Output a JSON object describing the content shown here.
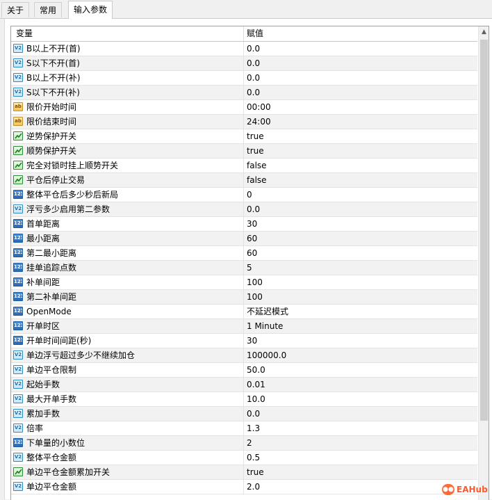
{
  "tabs": [
    {
      "label": "关于",
      "active": false
    },
    {
      "label": "常用",
      "active": false
    },
    {
      "label": "输入参数",
      "active": true
    }
  ],
  "columns": {
    "variable": "变量",
    "value": "赋值"
  },
  "icon_legend": {
    "V2": "double-value-icon",
    "123": "integer-value-icon",
    "ab": "string-value-icon",
    "bool": "boolean-value-icon"
  },
  "rows": [
    {
      "type": "V2",
      "name": "B以上不开(首)",
      "value": "0.0"
    },
    {
      "type": "V2",
      "name": "S以下不开(首)",
      "value": "0.0"
    },
    {
      "type": "V2",
      "name": "B以上不开(补)",
      "value": "0.0"
    },
    {
      "type": "V2",
      "name": "S以下不开(补)",
      "value": "0.0"
    },
    {
      "type": "ab",
      "name": "限价开始时间",
      "value": "00:00"
    },
    {
      "type": "ab",
      "name": "限价结束时间",
      "value": "24:00"
    },
    {
      "type": "bool",
      "name": "逆势保护开关",
      "value": "true"
    },
    {
      "type": "bool",
      "name": "顺势保护开关",
      "value": "true"
    },
    {
      "type": "bool",
      "name": "完全对锁时挂上顺势开关",
      "value": "false"
    },
    {
      "type": "bool",
      "name": "平仓后停止交易",
      "value": "false"
    },
    {
      "type": "123",
      "name": "整体平仓后多少秒后新局",
      "value": "0"
    },
    {
      "type": "V2",
      "name": "浮亏多少启用第二参数",
      "value": "0.0"
    },
    {
      "type": "123",
      "name": "首单距离",
      "value": "30"
    },
    {
      "type": "123",
      "name": "最小距离",
      "value": "60"
    },
    {
      "type": "123",
      "name": "第二最小距离",
      "value": "60"
    },
    {
      "type": "123",
      "name": "挂单追踪点数",
      "value": "5"
    },
    {
      "type": "123",
      "name": "补单间距",
      "value": "100"
    },
    {
      "type": "123",
      "name": "第二补单间距",
      "value": "100"
    },
    {
      "type": "123",
      "name": "OpenMode",
      "value": "不延迟模式"
    },
    {
      "type": "123",
      "name": "开单时区",
      "value": "1 Minute"
    },
    {
      "type": "123",
      "name": "开单时间间距(秒)",
      "value": "30"
    },
    {
      "type": "V2",
      "name": "单边浮亏超过多少不继续加仓",
      "value": "100000.0"
    },
    {
      "type": "V2",
      "name": "单边平仓限制",
      "value": "50.0"
    },
    {
      "type": "V2",
      "name": "起始手数",
      "value": "0.01"
    },
    {
      "type": "V2",
      "name": "最大开单手数",
      "value": "10.0"
    },
    {
      "type": "V2",
      "name": "累加手数",
      "value": "0.0"
    },
    {
      "type": "V2",
      "name": "倍率",
      "value": "1.3"
    },
    {
      "type": "123",
      "name": "下单量的小数位",
      "value": "2"
    },
    {
      "type": "V2",
      "name": "整体平仓金额",
      "value": "0.5"
    },
    {
      "type": "bool",
      "name": "单边平仓金额累加开关",
      "value": "true"
    },
    {
      "type": "V2",
      "name": "单边平仓金额",
      "value": "2.0"
    }
  ],
  "watermark": {
    "text": "EAHub"
  }
}
